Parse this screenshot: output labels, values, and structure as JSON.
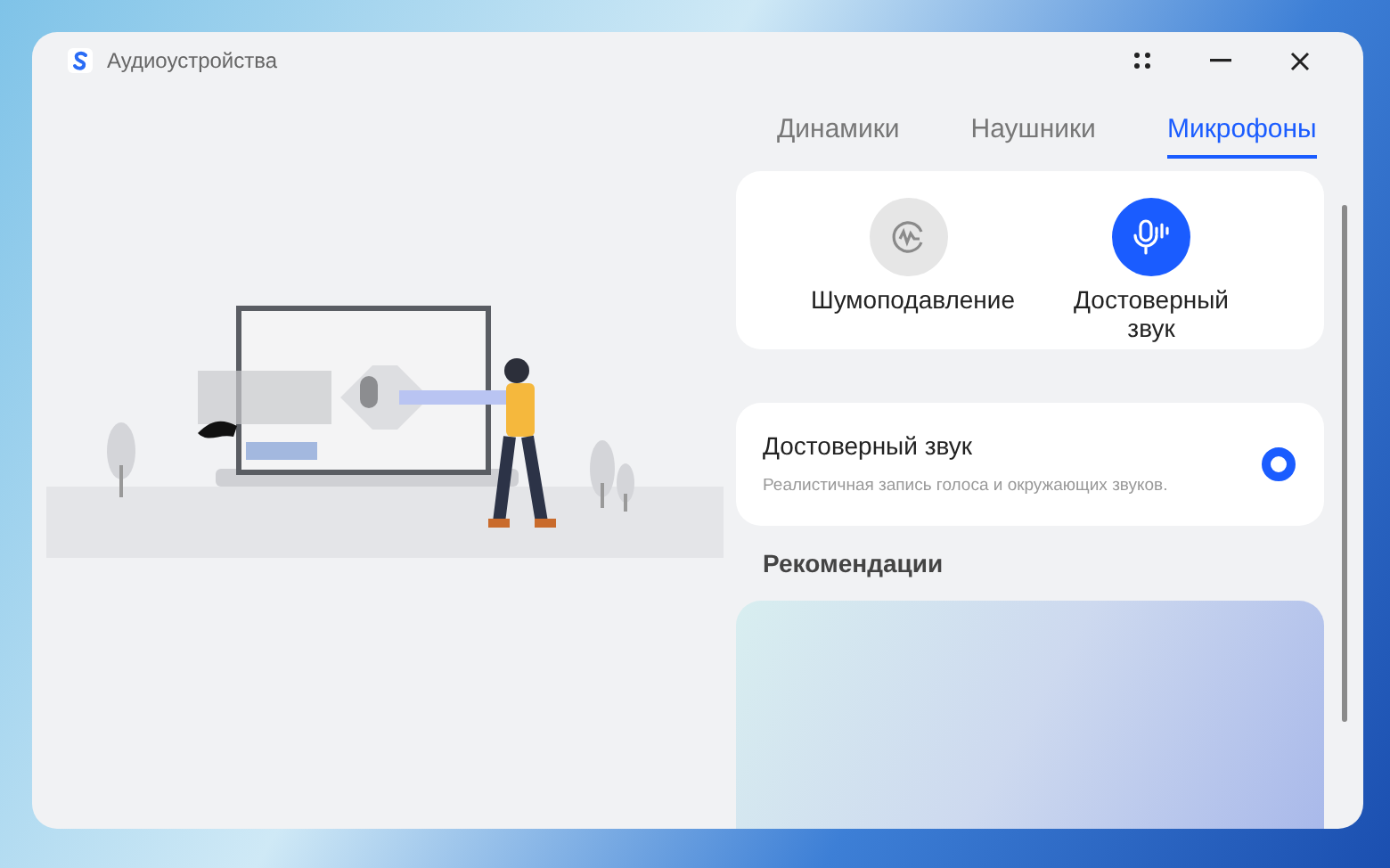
{
  "window": {
    "title": "Аудиоустройства"
  },
  "tabs": [
    {
      "label": "Динамики",
      "selected": false
    },
    {
      "label": "Наушники",
      "selected": false
    },
    {
      "label": "Микрофоны",
      "selected": true
    }
  ],
  "modes": [
    {
      "kind": "denoise",
      "label": "Шумоподавление",
      "selected": false
    },
    {
      "kind": "voice",
      "label": "Достоверный звук",
      "selected": true
    }
  ],
  "option": {
    "title": "Достоверный звук",
    "description": "Реалистичная запись голоса и окружающих звуков.",
    "selected": true
  },
  "recommendations": {
    "title": "Рекомендации"
  }
}
